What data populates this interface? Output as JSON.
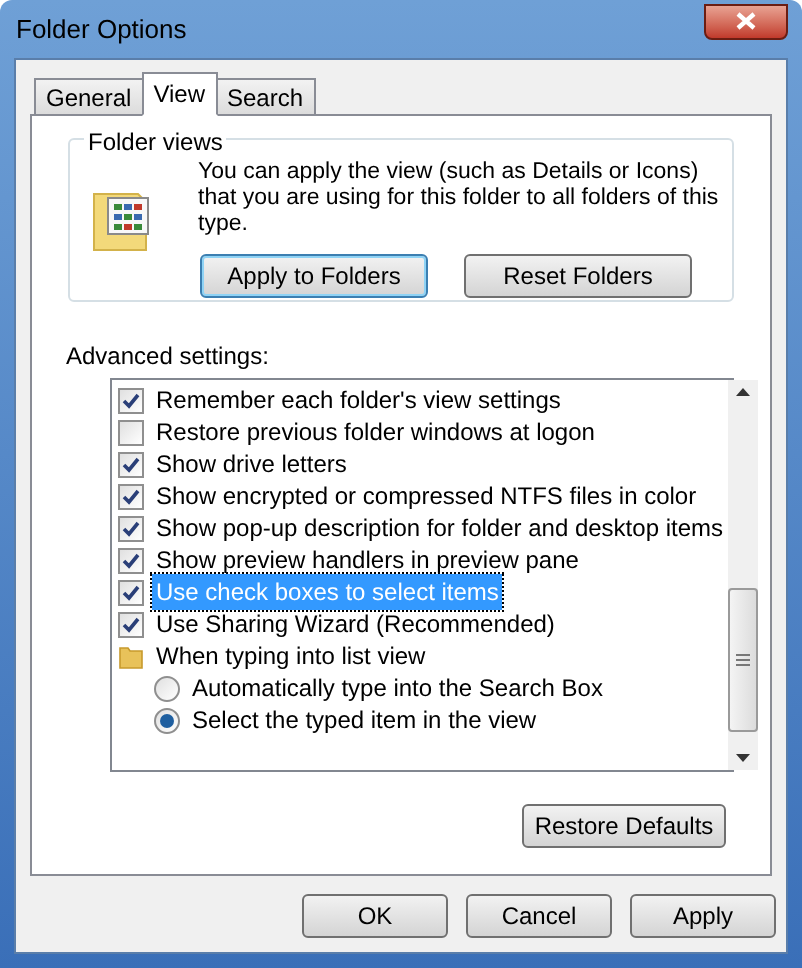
{
  "window": {
    "title": "Folder Options"
  },
  "tabs": [
    {
      "label": "General",
      "selected": false
    },
    {
      "label": "View",
      "selected": true
    },
    {
      "label": "Search",
      "selected": false
    }
  ],
  "folder_views": {
    "title": "Folder views",
    "description": "You can apply the view (such as Details or Icons) that you are using for this folder to all folders of this type.",
    "buttons": [
      {
        "label": "Apply to Folders",
        "focused": true
      },
      {
        "label": "Reset Folders",
        "focused": false
      }
    ]
  },
  "advanced": {
    "label": "Advanced settings:",
    "items": [
      {
        "kind": "checkbox",
        "label": "Remember each folder's view settings",
        "checked": true,
        "selected": false
      },
      {
        "kind": "checkbox",
        "label": "Restore previous folder windows at logon",
        "checked": false,
        "selected": false
      },
      {
        "kind": "checkbox",
        "label": "Show drive letters",
        "checked": true,
        "selected": false
      },
      {
        "kind": "checkbox",
        "label": "Show encrypted or compressed NTFS files in color",
        "checked": true,
        "selected": false
      },
      {
        "kind": "checkbox",
        "label": "Show pop-up description for folder and desktop items",
        "checked": true,
        "selected": false
      },
      {
        "kind": "checkbox",
        "label": "Show preview handlers in preview pane",
        "checked": true,
        "selected": false
      },
      {
        "kind": "checkbox",
        "label": "Use check boxes to select items",
        "checked": true,
        "selected": true
      },
      {
        "kind": "checkbox",
        "label": "Use Sharing Wizard (Recommended)",
        "checked": true,
        "selected": false
      },
      {
        "kind": "group",
        "label": "When typing into list view",
        "selected": false,
        "children": [
          {
            "kind": "radio",
            "label": "Automatically type into the Search Box",
            "checked": false,
            "selected": false
          },
          {
            "kind": "radio",
            "label": "Select the typed item in the view",
            "checked": true,
            "selected": false
          }
        ]
      }
    ],
    "restore_button": "Restore Defaults"
  },
  "buttons": [
    "OK",
    "Cancel",
    "Apply"
  ]
}
